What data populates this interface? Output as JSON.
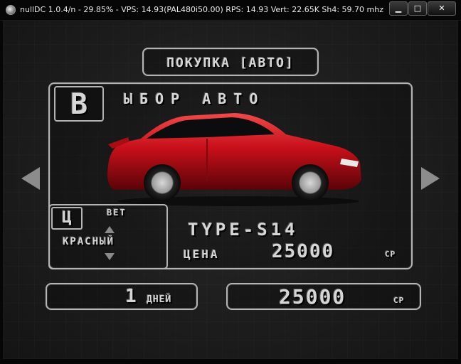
{
  "window": {
    "title": "nullDC 1.0.4/n - 29.85% - VPS: 14.93(PAL480i50.00) RPS: 14.93 Vert: 22.65K Sh4: 59.70 mhz",
    "min_label": "▁",
    "max_label": "□",
    "close_label": "✕"
  },
  "game": {
    "header": "ПОКУПКА [АВТО]",
    "choose_big_letter": "В",
    "choose_rest": "ЫБОР АВТО",
    "nav": {
      "left": "prev-arrow",
      "right": "next-arrow"
    },
    "car": {
      "body_color": "#c8101a",
      "model": "TYPE-S14"
    },
    "color": {
      "big_letter": "Ц",
      "rest": "ВЕТ",
      "value": "КРАСНЫЙ"
    },
    "type_label": "TYPE-S14",
    "price_label": "ЦЕНА",
    "price_value": "25000",
    "price_unit": "CP",
    "days_value": "1",
    "days_label": "ДНЕЙ",
    "money_value": "25000",
    "money_unit": "CP"
  },
  "colors": {
    "text": "#d6d6d6",
    "frame": "#b4b4b4",
    "car_red": "#c8101a"
  }
}
